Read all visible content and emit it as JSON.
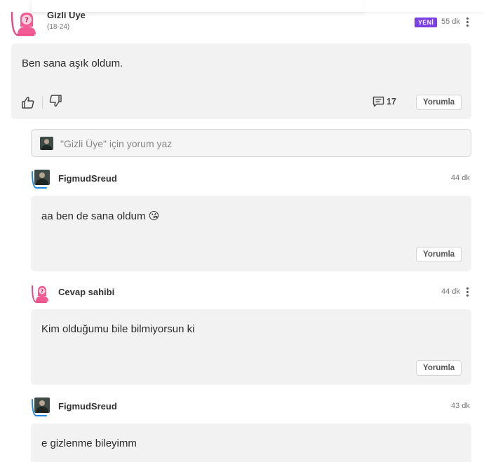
{
  "post": {
    "author": "Gizli Üye",
    "age_range": "(18-24)",
    "badge": "YENİ",
    "time": "55 dk",
    "text": "Ben sana aşık oldum.",
    "comment_count": "17",
    "reply_label": "Yorumla",
    "icons": [
      "like-icon",
      "dislike-icon",
      "comment-icon",
      "kebab-menu-icon"
    ]
  },
  "comment_input": {
    "placeholder": "\"Gizli Üye\" için yorum yaz"
  },
  "comments": [
    {
      "author": "FigmudSreud",
      "time": "44 dk",
      "text": "aa ben de sana oldum 😘",
      "reply_label": "Yorumla"
    },
    {
      "author": "Cevap sahibi",
      "time": "44 dk",
      "text": "Kim olduğumu bile bilmiyorsun ki",
      "reply_label": "Yorumla"
    },
    {
      "author": "FigmudSreud",
      "time": "43 dk",
      "text": "e gizlenme bileyimm"
    }
  ],
  "colors": {
    "accent_pink": "#e94b86",
    "accent_blue": "#1e88e5",
    "badge_purple": "#7b3fe4",
    "card_bg": "#f2f2f2"
  }
}
